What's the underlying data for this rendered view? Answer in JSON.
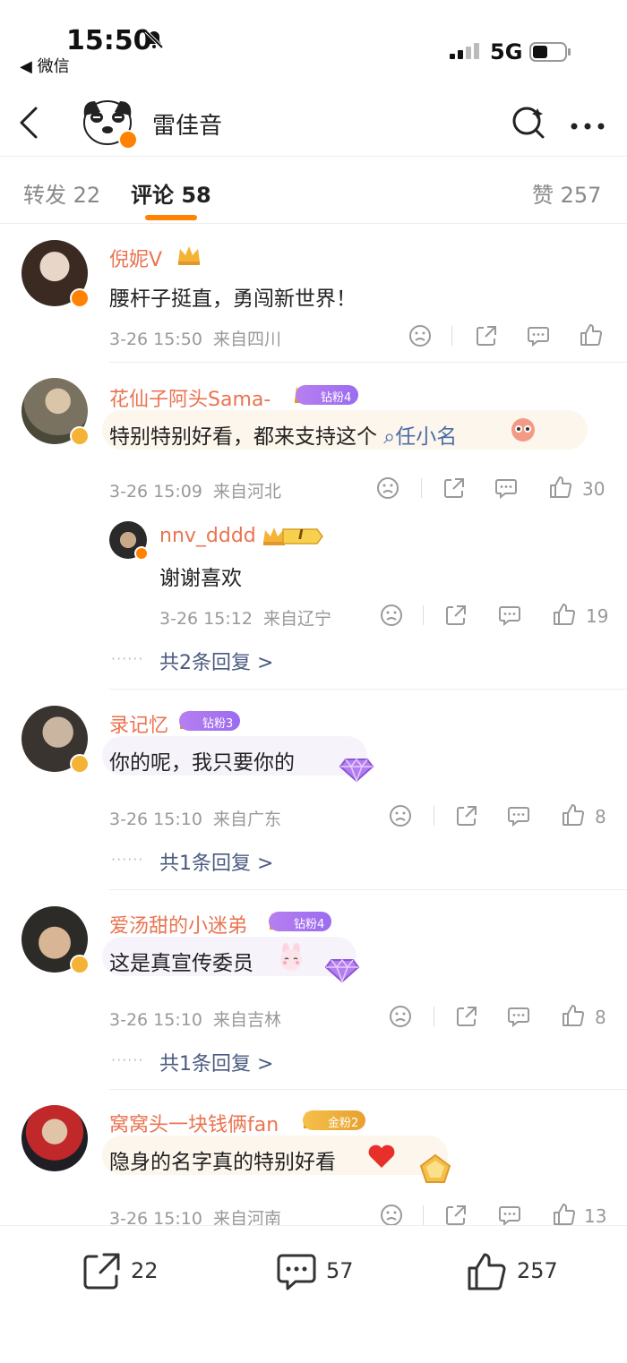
{
  "status_bar": {
    "time": "15:50",
    "back_app": "◀ 微信",
    "network": "5G",
    "icons": [
      "bell-mute-icon",
      "signal-icon",
      "battery-icon"
    ]
  },
  "header": {
    "title": "雷佳音",
    "icons": [
      "back-icon",
      "search-icon",
      "more-icon"
    ]
  },
  "tabs": {
    "reposts": "转发 22",
    "comments": "评论 58",
    "likes": "赞 257"
  },
  "comments": [
    {
      "name": "倪妮V",
      "text": "腰杆子挺直，勇闯新世界！",
      "time": "3-26 15:50",
      "location": "来自四川",
      "likes": ""
    },
    {
      "name": "花仙子阿头Sama-",
      "badge": "钻粉4",
      "text_before": "特别特别好看，都来支持这个",
      "topic": "任小名",
      "time": "3-26 15:09",
      "location": "来自河北",
      "likes": "30",
      "reply": {
        "name": "nnv_dddd",
        "level": "I",
        "text": "谢谢喜欢",
        "time": "3-26 15:12",
        "location": "来自辽宁",
        "likes": "19"
      },
      "replies_link": "共2条回复 >"
    },
    {
      "name": "录记忆",
      "badge": "钻粉3",
      "text": "你的呢，我只要你的",
      "time": "3-26 15:10",
      "location": "来自广东",
      "likes": "8",
      "replies_link": "共1条回复 >"
    },
    {
      "name": "爱汤甜的小迷弟",
      "badge": "钻粉4",
      "text": "这是真宣传委员",
      "time": "3-26 15:10",
      "location": "来自吉林",
      "likes": "8",
      "replies_link": "共1条回复 >"
    },
    {
      "name": "窝窝头一块钱俩fan",
      "badge": "金粉2",
      "text": "隐身的名字真的特别好看",
      "time": "3-26 15:10",
      "location": "来自河南",
      "likes": "13"
    }
  ],
  "bottom_bar": {
    "reposts": "22",
    "comments": "57",
    "likes": "257"
  },
  "colors": {
    "accent": "#ff8200",
    "name": "#eb7350",
    "meta": "#999999",
    "link": "#4a5a80",
    "badge_purple": "#b77ff0",
    "badge_gold": "#f0b040"
  }
}
